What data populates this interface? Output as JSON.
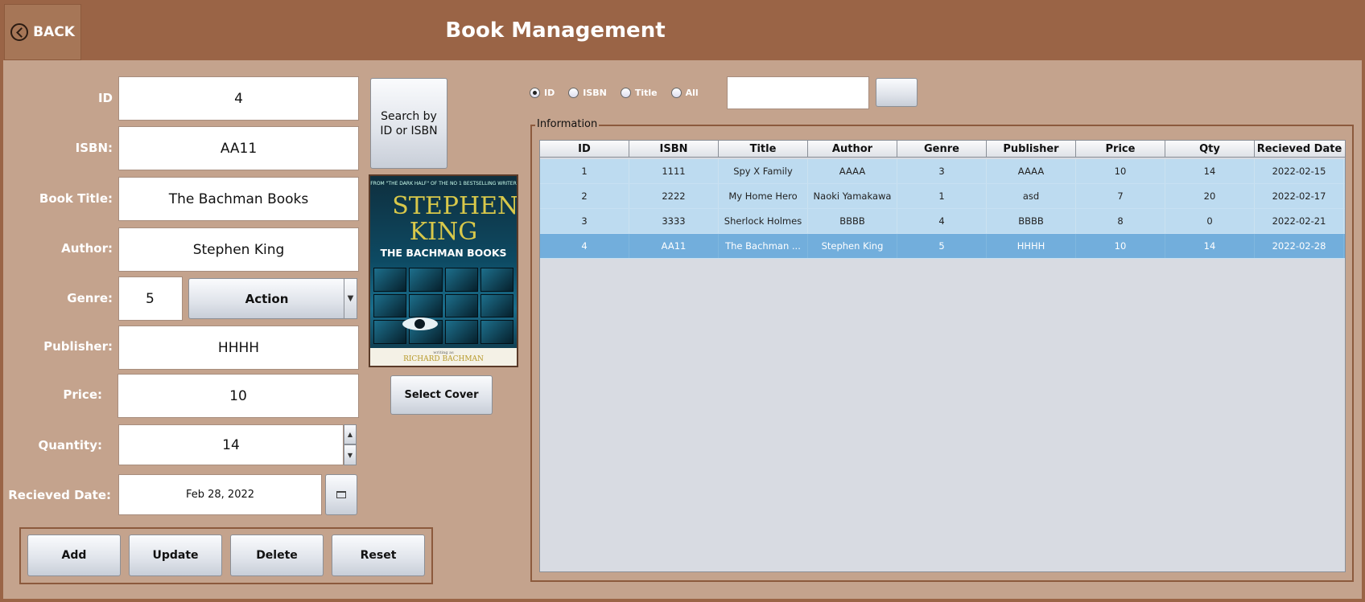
{
  "header": {
    "back_label": "BACK",
    "title": "Book Management"
  },
  "form": {
    "id_label": "ID",
    "id_value": "4",
    "isbn_label": "ISBN:",
    "isbn_value": "AA11",
    "title_label": "Book Title:",
    "title_value": "The Bachman Books",
    "author_label": "Author:",
    "author_value": "Stephen King",
    "genre_label": "Genre:",
    "genre_id": "5",
    "genre_selected": "Action",
    "publisher_label": "Publisher:",
    "publisher_value": "HHHH",
    "price_label": "Price:",
    "price_value": "10",
    "quantity_label": "Quantity:",
    "quantity_value": "14",
    "date_label": "Recieved Date:",
    "date_value": "Feb 28, 2022",
    "search_button": "Search by ID or ISBN",
    "select_cover": "Select Cover"
  },
  "cover": {
    "top_text": "FROM \"THE DARK HALF\" OF THE NO 1 BESTSELLING WRITER",
    "author": "STEPHEN KING",
    "title": "THE BACHMAN BOOKS",
    "byline": "writing as",
    "pen_name": "RICHARD BACHMAN"
  },
  "actions": {
    "add": "Add",
    "update": "Update",
    "delete": "Delete",
    "reset": "Reset"
  },
  "search": {
    "options": [
      {
        "label": "ID",
        "checked": true
      },
      {
        "label": "ISBN",
        "checked": false
      },
      {
        "label": "Title",
        "checked": false
      },
      {
        "label": "All",
        "checked": false
      }
    ],
    "query": "",
    "button_label": ""
  },
  "info": {
    "legend": "Information",
    "columns": [
      "ID",
      "ISBN",
      "Title",
      "Author",
      "Genre",
      "Publisher",
      "Price",
      "Qty",
      "Recieved Date"
    ],
    "rows": [
      [
        "1",
        "1111",
        "Spy X Family",
        "AAAA",
        "3",
        "AAAA",
        "10",
        "14",
        "2022-02-15"
      ],
      [
        "2",
        "2222",
        "My Home Hero",
        "Naoki Yamakawa",
        "1",
        "asd",
        "7",
        "20",
        "2022-02-17"
      ],
      [
        "3",
        "3333",
        "Sherlock Holmes",
        "BBBB",
        "4",
        "BBBB",
        "8",
        "0",
        "2022-02-21"
      ],
      [
        "4",
        "AA11",
        "The Bachman ...",
        "Stephen King",
        "5",
        "HHHH",
        "10",
        "14",
        "2022-02-28"
      ]
    ],
    "selected_row": 3
  },
  "colors": {
    "background": "#c4a38d",
    "header": "#9a6446",
    "row": "#bddbf0",
    "row_selected": "#72aedc"
  }
}
